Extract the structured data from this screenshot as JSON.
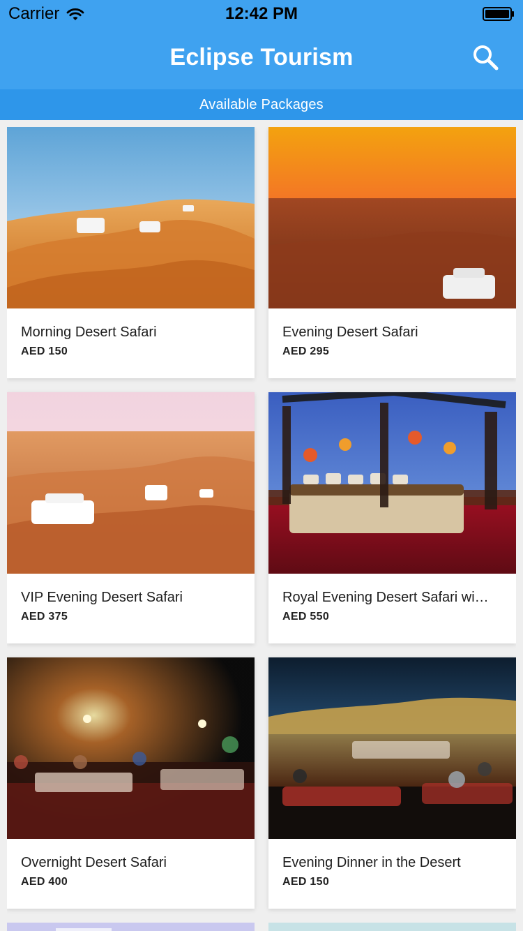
{
  "status_bar": {
    "carrier": "Carrier",
    "time": "12:42 PM"
  },
  "nav": {
    "title": "Eclipse Tourism",
    "search_icon": "search-icon"
  },
  "subbar": {
    "label": "Available Packages"
  },
  "packages": [
    {
      "title": "Morning Desert Safari",
      "price": "AED 150"
    },
    {
      "title": "Evening Desert Safari",
      "price": "AED 295"
    },
    {
      "title": "VIP Evening Desert Safari",
      "price": "AED 375"
    },
    {
      "title": "Royal Evening Desert Safari wi…",
      "price": "AED 550"
    },
    {
      "title": "Overnight Desert Safari",
      "price": "AED 400"
    },
    {
      "title": "Evening Dinner in the Desert",
      "price": "AED 150"
    }
  ],
  "colors": {
    "header": "#3fa2f0",
    "subbar": "#2e96ea",
    "background": "#efefef"
  }
}
